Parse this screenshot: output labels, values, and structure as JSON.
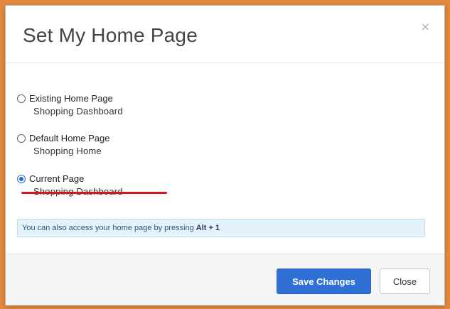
{
  "dialog": {
    "title": "Set My Home Page",
    "close_icon": "×"
  },
  "options": [
    {
      "label": "Existing Home Page",
      "sub": "Shopping Dashboard",
      "checked": false
    },
    {
      "label": "Default Home Page",
      "sub": "Shopping Home",
      "checked": false
    },
    {
      "label": "Current Page",
      "sub": "Shopping Dashboard",
      "checked": true
    }
  ],
  "info": {
    "text": "You can also access your home page by pressing",
    "keys": "Alt + 1"
  },
  "footer": {
    "save_label": "Save Changes",
    "close_label": "Close"
  },
  "colors": {
    "primary": "#2f6fd6",
    "annotation": "#d9141a",
    "info_bg": "#e3f2fb"
  }
}
